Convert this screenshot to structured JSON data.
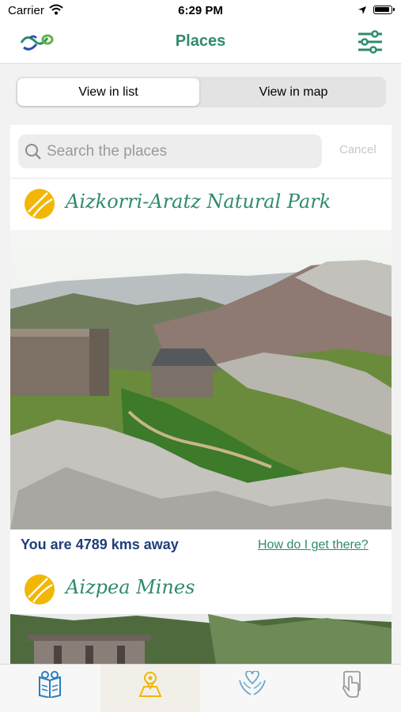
{
  "status": {
    "carrier": "Carrier",
    "time": "6:29 PM"
  },
  "nav": {
    "title": "Places"
  },
  "segments": {
    "list": "View in list",
    "map": "View in map"
  },
  "search": {
    "placeholder": "Search the places",
    "cancel": "Cancel"
  },
  "places": [
    {
      "name": "Aizkorri-Aratz Natural Park",
      "distance": "You are 4789 kms away",
      "link": "How do I get there?"
    },
    {
      "name": "Aizpea Mines"
    }
  ],
  "colors": {
    "accent": "#2e8b6d",
    "distance": "#1e3f7a",
    "place_icon": "#f2b705"
  },
  "tabs": [
    {
      "icon": "book-icon"
    },
    {
      "icon": "map-pin-icon",
      "active": true
    },
    {
      "icon": "hands-heart-icon"
    },
    {
      "icon": "touch-hand-icon"
    }
  ]
}
